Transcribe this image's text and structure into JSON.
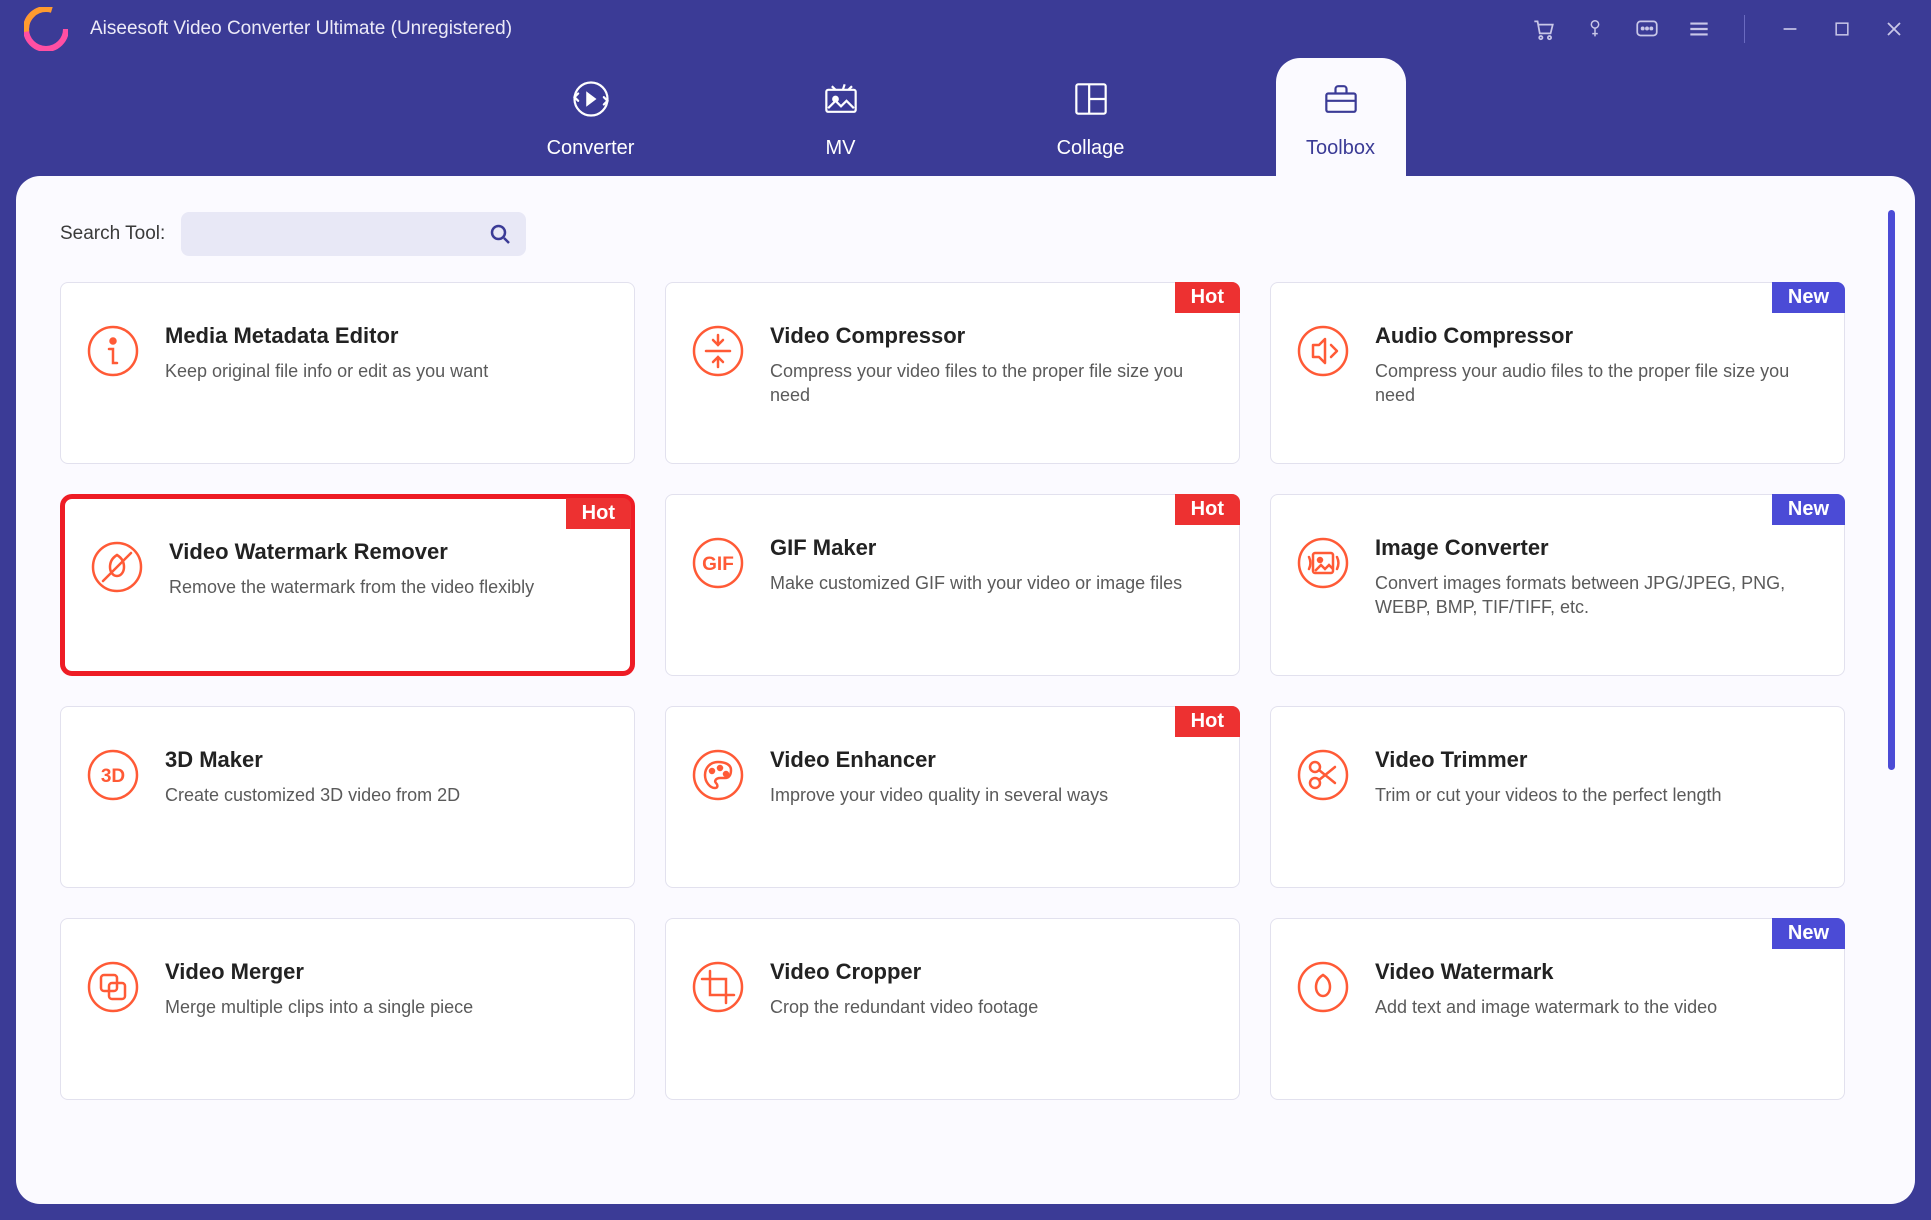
{
  "titlebar": {
    "app_title": "Aiseesoft Video Converter Ultimate (Unregistered)"
  },
  "tabs": {
    "converter": "Converter",
    "mv": "MV",
    "collage": "Collage",
    "toolbox": "Toolbox",
    "active": "toolbox"
  },
  "search": {
    "label": "Search Tool:",
    "value": ""
  },
  "badges": {
    "hot": "Hot",
    "new": "New"
  },
  "tools": [
    {
      "id": "media-metadata-editor",
      "title": "Media Metadata Editor",
      "desc": "Keep original file info or edit as you want",
      "badge": null,
      "highlight": false,
      "icon": "info"
    },
    {
      "id": "video-compressor",
      "title": "Video Compressor",
      "desc": "Compress your video files to the proper file size you need",
      "badge": "hot",
      "highlight": false,
      "icon": "compress"
    },
    {
      "id": "audio-compressor",
      "title": "Audio Compressor",
      "desc": "Compress your audio files to the proper file size you need",
      "badge": "new",
      "highlight": false,
      "icon": "audio-compress"
    },
    {
      "id": "video-watermark-remover",
      "title": "Video Watermark Remover",
      "desc": "Remove the watermark from the video flexibly",
      "badge": "hot",
      "highlight": true,
      "icon": "watermark-remove"
    },
    {
      "id": "gif-maker",
      "title": "GIF Maker",
      "desc": "Make customized GIF with your video or image files",
      "badge": "hot",
      "highlight": false,
      "icon": "gif"
    },
    {
      "id": "image-converter",
      "title": "Image Converter",
      "desc": "Convert images formats between JPG/JPEG, PNG, WEBP, BMP, TIF/TIFF, etc.",
      "badge": "new",
      "highlight": false,
      "icon": "image-convert"
    },
    {
      "id": "3d-maker",
      "title": "3D Maker",
      "desc": "Create customized 3D video from 2D",
      "badge": null,
      "highlight": false,
      "icon": "3d"
    },
    {
      "id": "video-enhancer",
      "title": "Video Enhancer",
      "desc": "Improve your video quality in several ways",
      "badge": "hot",
      "highlight": false,
      "icon": "palette"
    },
    {
      "id": "video-trimmer",
      "title": "Video Trimmer",
      "desc": "Trim or cut your videos to the perfect length",
      "badge": null,
      "highlight": false,
      "icon": "scissors"
    },
    {
      "id": "video-merger",
      "title": "Video Merger",
      "desc": "Merge multiple clips into a single piece",
      "badge": null,
      "highlight": false,
      "icon": "merge"
    },
    {
      "id": "video-cropper",
      "title": "Video Cropper",
      "desc": "Crop the redundant video footage",
      "badge": null,
      "highlight": false,
      "icon": "crop"
    },
    {
      "id": "video-watermark",
      "title": "Video Watermark",
      "desc": "Add text and image watermark to the video",
      "badge": "new",
      "highlight": false,
      "icon": "watermark"
    }
  ],
  "colors": {
    "accent": "#3b3b96",
    "hot": "#ed3131",
    "new": "#4b4bd6",
    "icon": "#ff5a36",
    "highlight": "#ee1c25"
  }
}
